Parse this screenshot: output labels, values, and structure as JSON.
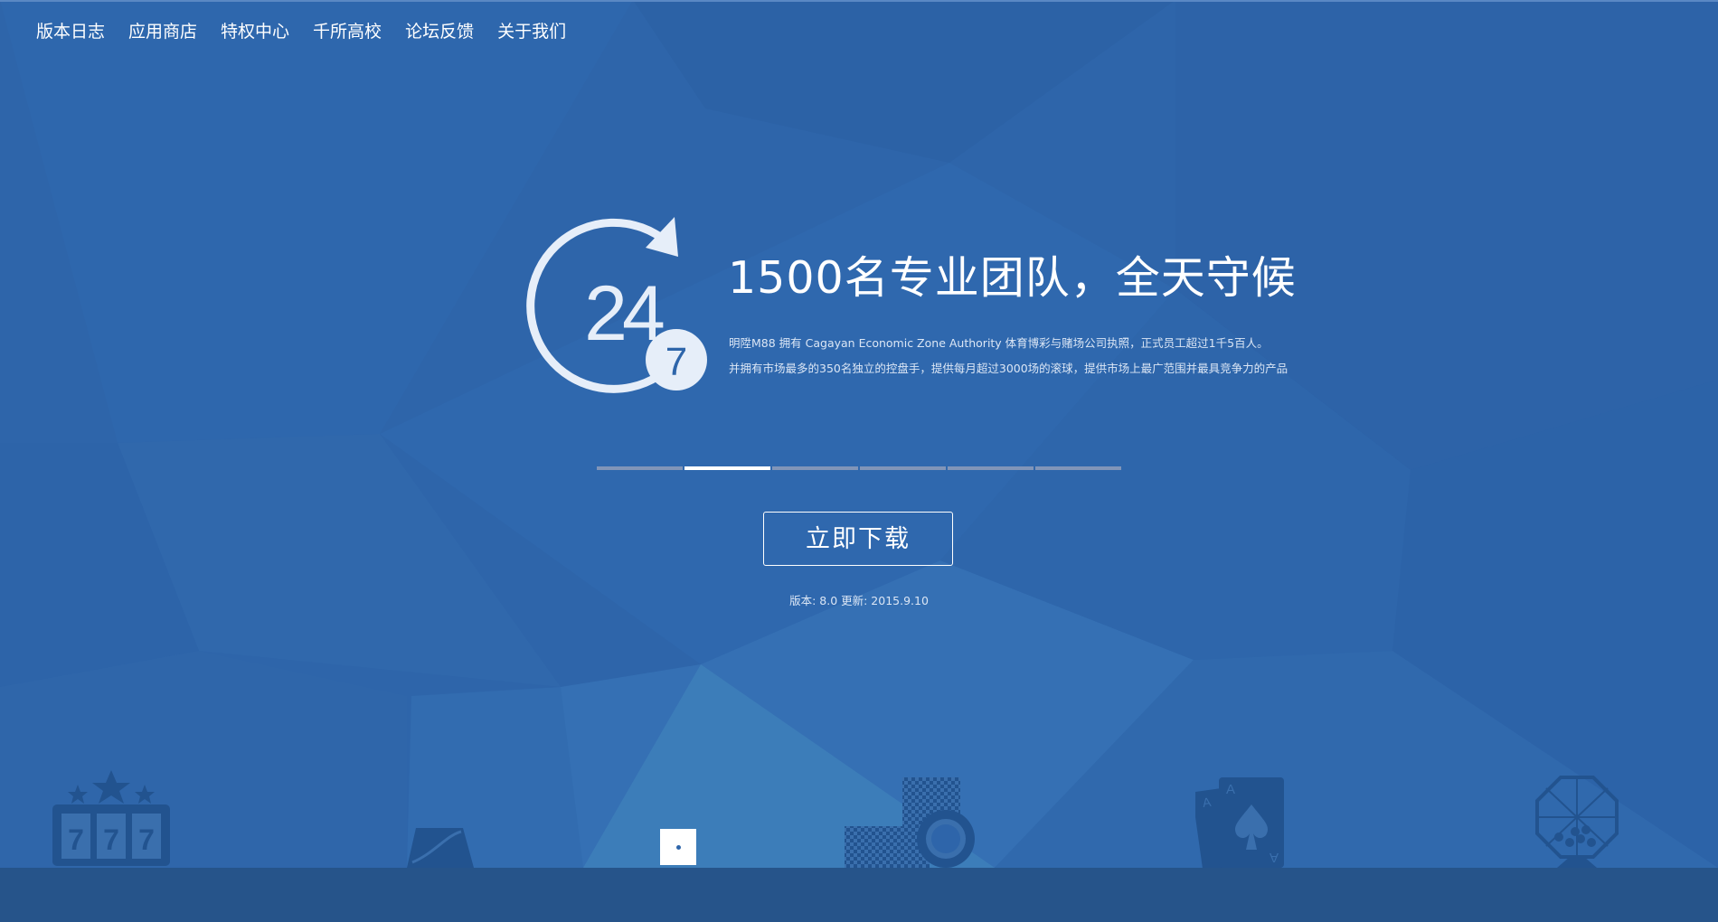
{
  "nav": {
    "items": [
      {
        "label": "版本日志"
      },
      {
        "label": "应用商店"
      },
      {
        "label": "特权中心"
      },
      {
        "label": "千所高校"
      },
      {
        "label": "论坛反馈"
      },
      {
        "label": "关于我们"
      }
    ]
  },
  "hero": {
    "icon_name": "clock-24-7-icon",
    "icon_text_main": "24",
    "icon_text_sub": "7",
    "title": "1500名专业团队，全天守候",
    "desc_line1": "明陞M88 拥有 Cagayan Economic Zone Authority 体育博彩与赌场公司执照，正式员工超过1千5百人。",
    "desc_line2": "并拥有市场最多的350名独立的控盘手，提供每月超过3000场的滚球，提供市场上最广范围并最具竞争力的产品"
  },
  "carousel": {
    "slide_count": 6,
    "active_index": 1
  },
  "download": {
    "label": "立即下载",
    "version_text": "版本: 8.0 更新: 2015.9.10"
  },
  "decor_icons": [
    "slot-machine-777-icon",
    "card-shoe-icon",
    "chat-icon",
    "poker-chips-icon",
    "playing-cards-icon",
    "lottery-ball-cage-icon"
  ],
  "colors": {
    "background": "#2e65aa",
    "footer": "#26548a",
    "accent": "#ffffff"
  }
}
